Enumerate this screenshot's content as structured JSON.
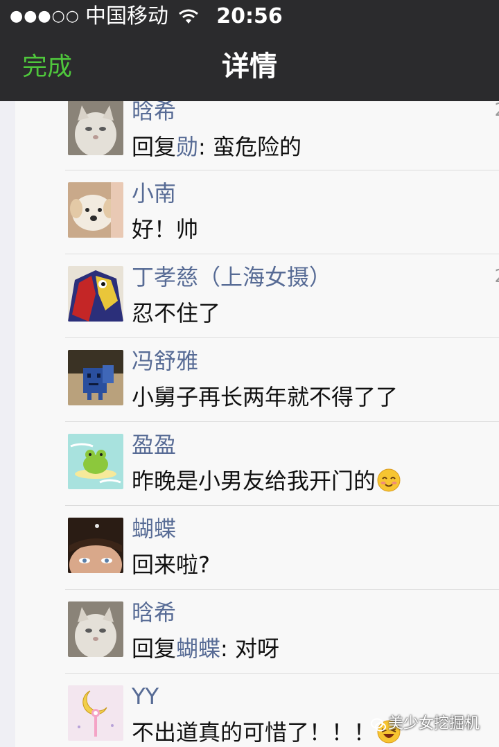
{
  "status_bar": {
    "signal_dots": "●●●○○",
    "carrier": "中国移动",
    "time": "20:56"
  },
  "nav": {
    "done_label": "完成",
    "title": "详情"
  },
  "comments": [
    {
      "name": "晗希",
      "reply_prefix": "回复",
      "reply_to": "勋",
      "text": ": 蛮危险的",
      "timestamp_partial": "2",
      "avatar": "cat-avatar-icon"
    },
    {
      "name": "小南",
      "text": "好！帅",
      "avatar": "puppy-avatar-icon"
    },
    {
      "name": "丁孝慈（上海女摄）",
      "text": "忍不住了",
      "timestamp_partial": "2",
      "avatar": "bird-avatar-icon"
    },
    {
      "name": "冯舒雅",
      "text": "小舅子再长两年就不得了了",
      "avatar": "robot-box-avatar-icon"
    },
    {
      "name": "盈盈",
      "text": "昨晚是小男友给我开门的",
      "emoji": "smiling-blushing-emoji-icon",
      "avatar": "frog-avatar-icon"
    },
    {
      "name": "蝴蝶",
      "text": "回来啦?",
      "avatar": "face-avatar-icon"
    },
    {
      "name": "晗希",
      "reply_prefix": "回复",
      "reply_to": "蝴蝶",
      "text": ": 对呀",
      "avatar": "cat-avatar-icon"
    },
    {
      "name": "YY",
      "text": "不出道真的可惜了！！！",
      "emoji": "laughing-emoji-icon",
      "avatar": "moon-wand-avatar-icon"
    }
  ],
  "watermark": {
    "text": "美少女挖掘机",
    "icon": "wechat-icon"
  },
  "colors": {
    "nav_bg": "#2b2b2d",
    "done_green": "#4fc73c",
    "name_blue": "#576b95"
  }
}
